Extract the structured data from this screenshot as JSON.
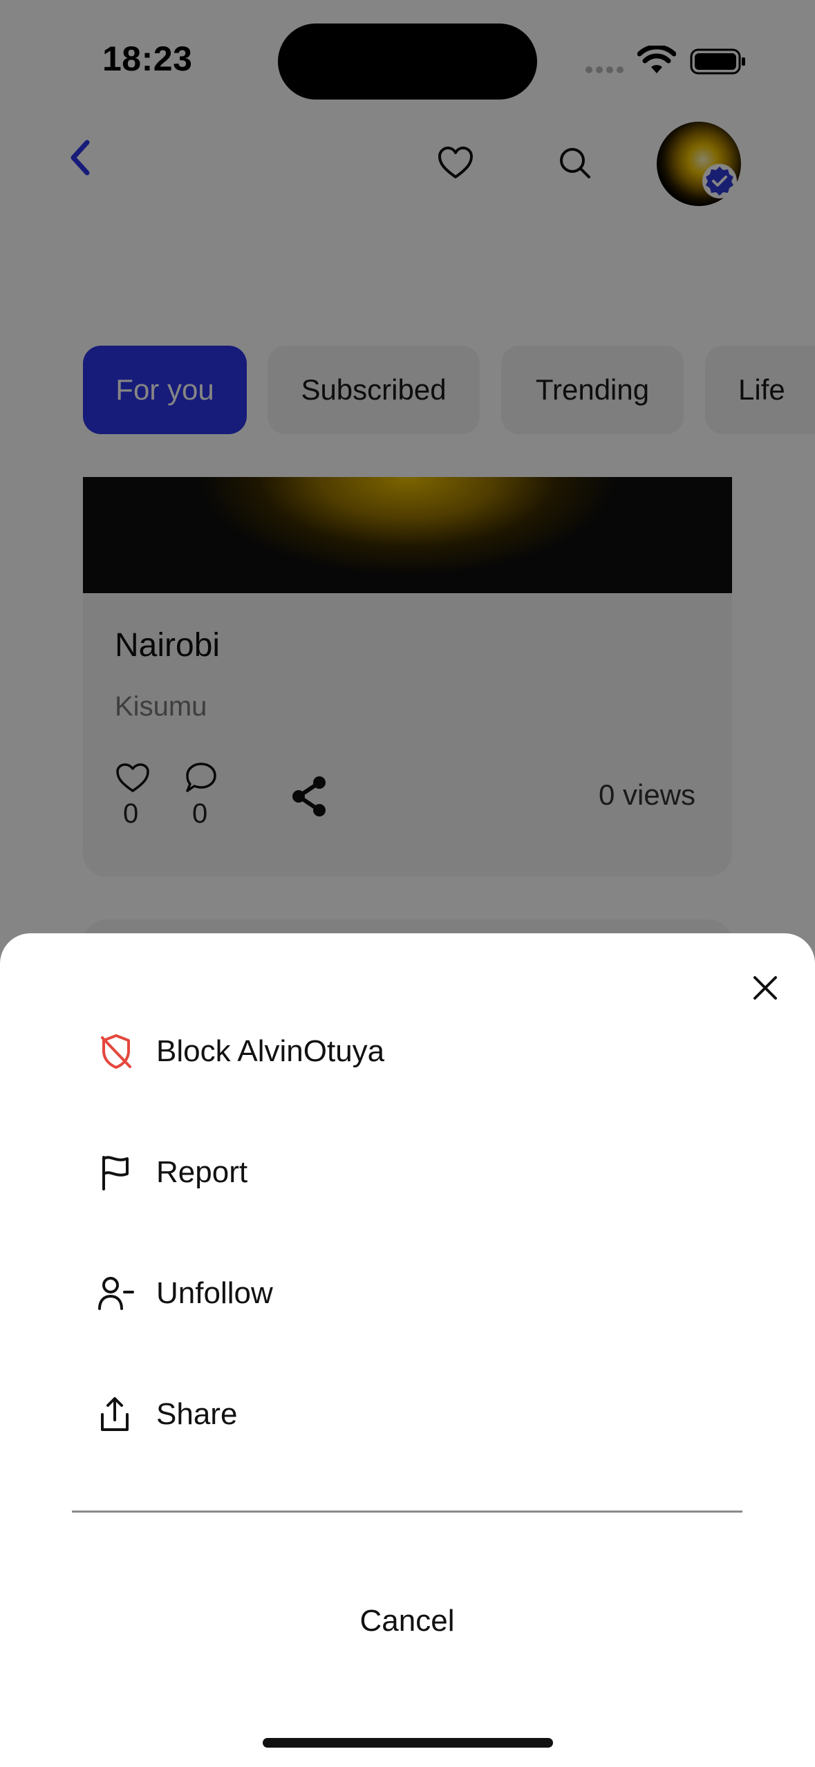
{
  "status_bar": {
    "time": "18:23"
  },
  "header": {
    "back_icon": "chevron-left-icon",
    "favorites_icon": "heart-icon",
    "search_icon": "search-icon",
    "avatar_badge_icon": "verified-badge-icon"
  },
  "tabs": [
    {
      "label": "For you",
      "active": true
    },
    {
      "label": "Subscribed",
      "active": false
    },
    {
      "label": "Trending",
      "active": false
    },
    {
      "label": "Life",
      "active": false
    }
  ],
  "post": {
    "title": "Nairobi",
    "subtitle": "Kisumu",
    "likes": "0",
    "comments": "0",
    "views": "0 views"
  },
  "sheet": {
    "items": [
      {
        "label": "Block AlvinOtuya",
        "icon": "shield-off-icon",
        "color": "#e5483d"
      },
      {
        "label": "Report",
        "icon": "flag-icon"
      },
      {
        "label": "Unfollow",
        "icon": "user-minus-icon"
      },
      {
        "label": "Share",
        "icon": "share-upload-icon"
      }
    ],
    "cancel_label": "Cancel"
  },
  "colors": {
    "accent": "#2c35e8",
    "danger": "#e5483d",
    "verified": "#2f3bd6"
  }
}
